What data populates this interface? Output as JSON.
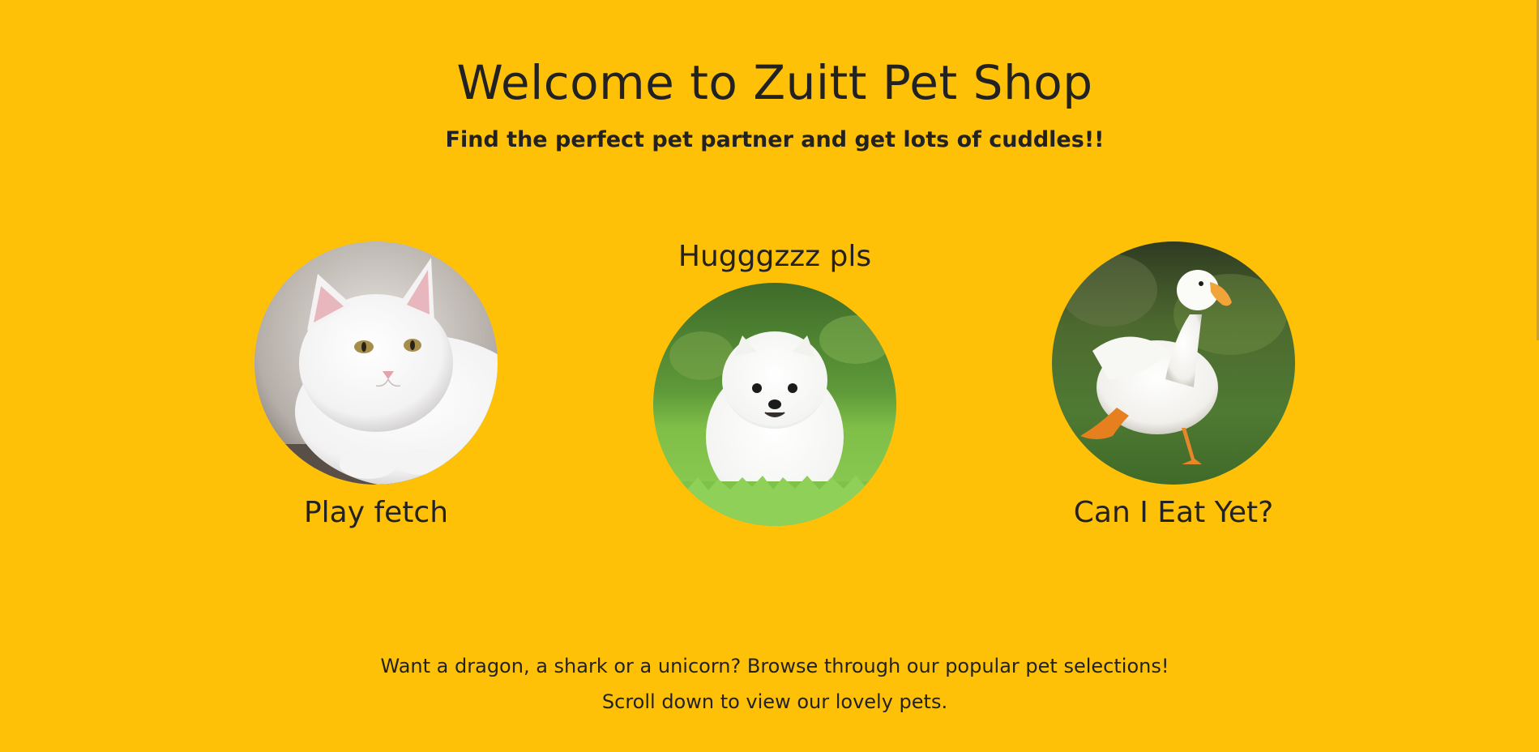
{
  "header": {
    "title": "Welcome to Zuitt Pet Shop",
    "subtitle": "Find the perfect pet partner and get lots of cuddles!!"
  },
  "pets": [
    {
      "name": "cat",
      "caption": "Play fetch",
      "icon": "cat-photo"
    },
    {
      "name": "dog",
      "caption": "Hugggzzz pls",
      "icon": "dog-photo"
    },
    {
      "name": "duck",
      "caption": "Can I Eat Yet?",
      "icon": "duck-photo"
    }
  ],
  "footer": {
    "line1": "Want a dragon, a shark or a unicorn? Browse through our popular pet selections!",
    "line2": "Scroll down to view our lovely pets."
  },
  "colors": {
    "background": "#FFC107",
    "text": "#212121"
  }
}
